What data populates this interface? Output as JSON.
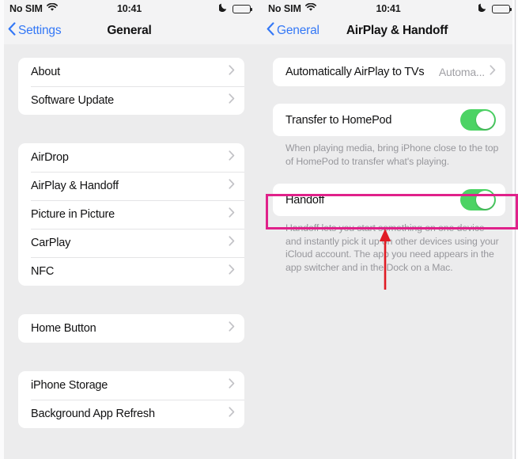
{
  "left_screen": {
    "status_bar": {
      "carrier": "No SIM",
      "wifi_icon": "wifi-icon",
      "time": "10:41",
      "dnd_icon": "moon-icon",
      "battery_icon": "battery-icon"
    },
    "nav": {
      "back_label": "Settings",
      "back_icon": "chevron-left-icon",
      "title": "General"
    },
    "groups": [
      {
        "rows": [
          {
            "label": "About",
            "chevron": "chevron-right-icon"
          },
          {
            "label": "Software Update",
            "chevron": "chevron-right-icon"
          }
        ]
      },
      {
        "rows": [
          {
            "label": "AirDrop",
            "chevron": "chevron-right-icon"
          },
          {
            "label": "AirPlay & Handoff",
            "chevron": "chevron-right-icon"
          },
          {
            "label": "Picture in Picture",
            "chevron": "chevron-right-icon"
          },
          {
            "label": "CarPlay",
            "chevron": "chevron-right-icon"
          },
          {
            "label": "NFC",
            "chevron": "chevron-right-icon"
          }
        ]
      },
      {
        "rows": [
          {
            "label": "Home Button",
            "chevron": "chevron-right-icon"
          }
        ]
      },
      {
        "rows": [
          {
            "label": "iPhone Storage",
            "chevron": "chevron-right-icon"
          },
          {
            "label": "Background App Refresh",
            "chevron": "chevron-right-icon"
          }
        ]
      }
    ]
  },
  "right_screen": {
    "status_bar": {
      "carrier": "No SIM",
      "wifi_icon": "wifi-icon",
      "time": "10:41",
      "dnd_icon": "moon-icon",
      "battery_icon": "battery-icon"
    },
    "nav": {
      "back_label": "General",
      "back_icon": "chevron-left-icon",
      "title": "AirPlay & Handoff"
    },
    "airplay_row": {
      "label": "Automatically AirPlay to TVs",
      "value": "Automa...",
      "chevron": "chevron-right-icon"
    },
    "homepod_row": {
      "label": "Transfer to HomePod",
      "toggle_state": "on"
    },
    "homepod_footnote": "When playing media, bring iPhone close to the top of HomePod to transfer what's playing.",
    "handoff_row": {
      "label": "Handoff",
      "toggle_state": "on"
    },
    "handoff_footnote": "Handoff lets you start something on one device and instantly pick it up on other devices using your iCloud account. The app you need appears in the app switcher and in the Dock on a Mac."
  },
  "annotations": {
    "highlight_color": "#e0218a",
    "arrow_color": "#e01b24",
    "highlight_target": "handoff-row",
    "arrow_target": "handoff-row"
  },
  "colors": {
    "accent_blue": "#3478f6",
    "toggle_green": "#4cd364",
    "background_gray": "#ececed",
    "card_white": "#ffffff"
  }
}
